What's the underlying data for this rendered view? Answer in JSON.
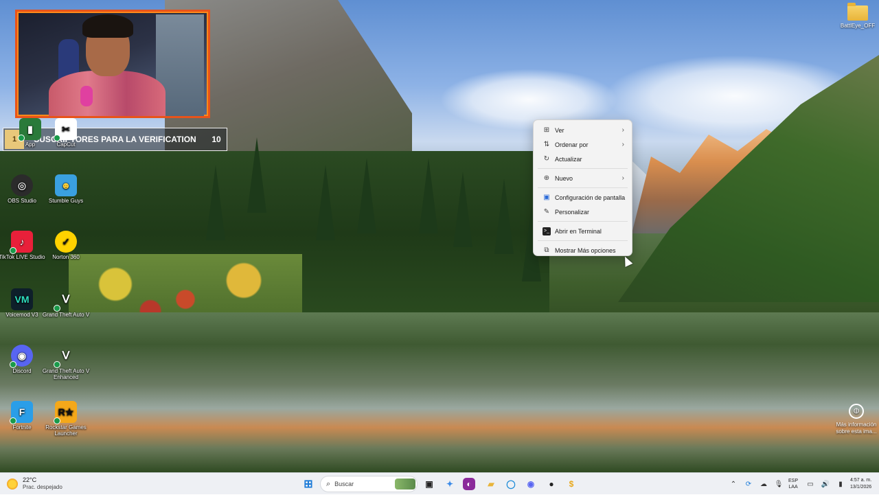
{
  "subscriber_overlay": {
    "current": "1",
    "title": "SUSCRIPTORES PARA LA VERIFICATION",
    "goal": "10"
  },
  "desktop_icons": [
    {
      "label": "App"
    },
    {
      "label": "CapCut"
    },
    {
      "label": "OBS Studio"
    },
    {
      "label": "Stumble Guys"
    },
    {
      "label": "TikTok LIVE Studio"
    },
    {
      "label": "Norton 360"
    },
    {
      "label": "Voicemod V3"
    },
    {
      "label": "Grand Theft Auto V"
    },
    {
      "label": "Discord"
    },
    {
      "label": "Grand Theft Auto V Enhanced"
    },
    {
      "label": "Fortnite"
    },
    {
      "label": "Rockstar Games Launcher"
    }
  ],
  "battleye": {
    "label": "BattlEye_OFF"
  },
  "more_info": {
    "label": "Más información sobre esta ima..."
  },
  "context_menu": {
    "items": [
      {
        "label": "Ver",
        "icon": "grid-icon",
        "has_submenu": true
      },
      {
        "label": "Ordenar por",
        "icon": "sort-icon",
        "has_submenu": true
      },
      {
        "label": "Actualizar",
        "icon": "refresh-icon",
        "has_submenu": false
      },
      {
        "label": "Nuevo",
        "icon": "plus-circle-icon",
        "has_submenu": true
      },
      {
        "label": "Configuración de pantalla",
        "icon": "display-icon",
        "has_submenu": false
      },
      {
        "label": "Personalizar",
        "icon": "brush-icon",
        "has_submenu": false
      },
      {
        "label": "Abrir en Terminal",
        "icon": "terminal-icon",
        "has_submenu": false
      },
      {
        "label": "Mostrar Más opciones",
        "icon": "more-options-icon",
        "has_submenu": false
      }
    ]
  },
  "taskbar": {
    "weather_temp": "22°C",
    "weather_desc": "Prac. despejado",
    "search_placeholder": "Buscar",
    "lang_top": "ESP",
    "lang_bottom": "LAA",
    "time": "4:57 a. m.",
    "date": "13/1/2026"
  },
  "colors": {
    "webcam_border": "#e8531a",
    "menu_bg": "#f3f3f3",
    "taskbar_bg": "#eef0f4"
  }
}
